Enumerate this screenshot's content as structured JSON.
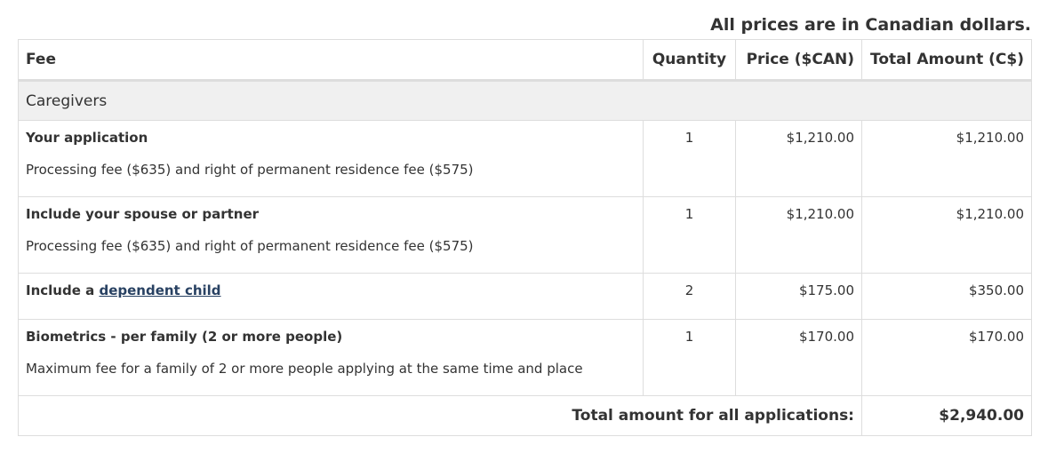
{
  "note": "All prices are in Canadian dollars.",
  "columns": {
    "fee": "Fee",
    "quantity": "Quantity",
    "price": "Price ($CAN)",
    "total": "Total Amount (C$)"
  },
  "group": "Caregivers",
  "rows": [
    {
      "title": "Your application",
      "description": "Processing fee ($635) and right of permanent residence fee ($575)",
      "quantity": "1",
      "price": "$1,210.00",
      "total": "$1,210.00"
    },
    {
      "title": "Include your spouse or partner",
      "description": "Processing fee ($635) and right of permanent residence fee ($575)",
      "quantity": "1",
      "price": "$1,210.00",
      "total": "$1,210.00"
    },
    {
      "title_prefix": "Include a",
      "title_link": "dependent child",
      "quantity": "2",
      "price": "$175.00",
      "total": "$350.00"
    },
    {
      "title": "Biometrics - per family (2 or more people)",
      "description": "Maximum fee for a family of 2 or more people applying at the same time and place",
      "quantity": "1",
      "price": "$170.00",
      "total": "$170.00"
    }
  ],
  "summary": {
    "label": "Total amount for all applications:",
    "value": "$2,940.00"
  },
  "colors": {
    "link": "#284162",
    "group_bg": "#f0f0f0",
    "border": "#dddddd"
  }
}
